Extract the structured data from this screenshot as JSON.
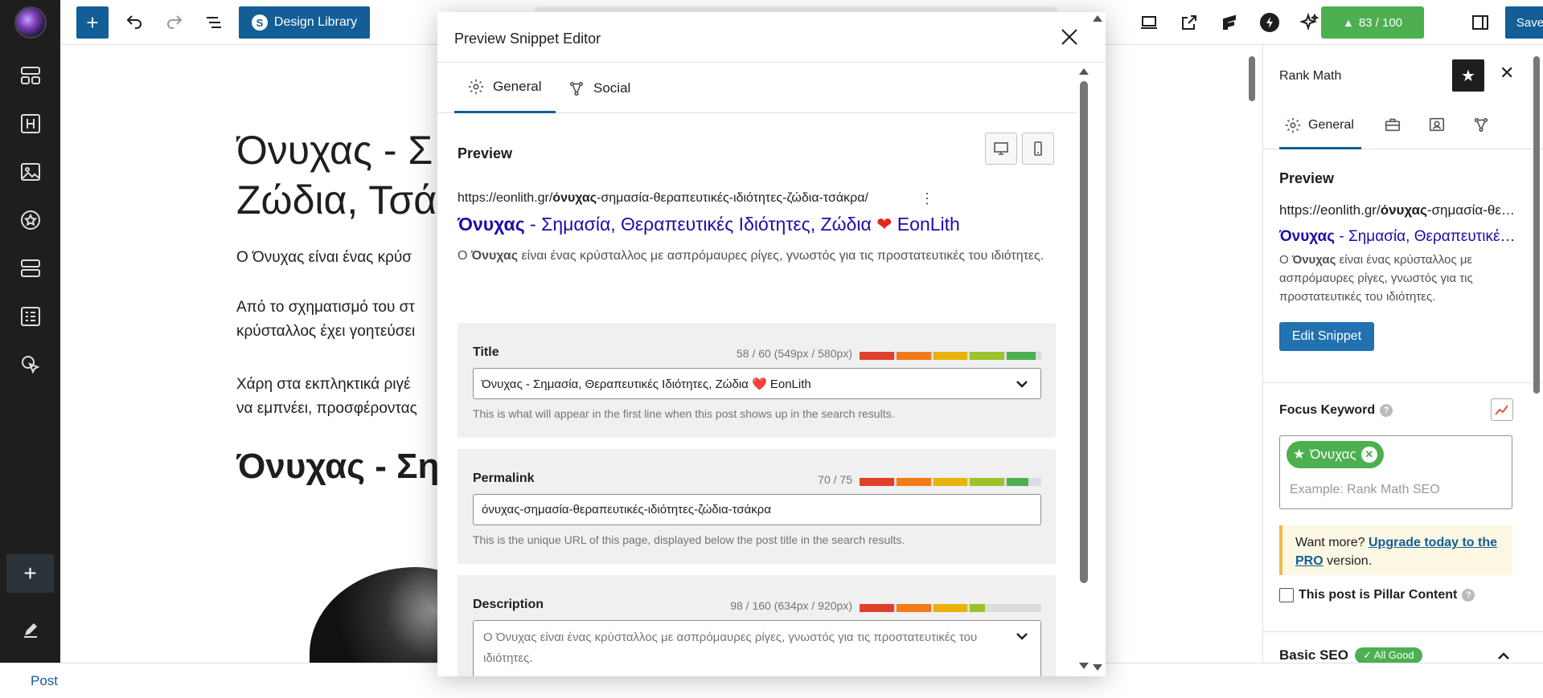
{
  "toolbar": {
    "design_library_label": "Design Library",
    "score_label": "83 / 100",
    "save_label": "Save"
  },
  "editor": {
    "title_line1": "Όνυχας - Σ",
    "title_line2": "Ζώδια, Τσά",
    "para1": "Ο Όνυχας είναι ένας κρύσ",
    "para2_line1": "Από το σχηματισμό του στ",
    "para2_line2": "κρύσταλλος έχει γοητεύσει",
    "para3_line1": "Χάρη στα εκπληκτικά ριγέ",
    "para3_line2": "να εμπνέει, προσφέροντας",
    "heading2": "Όνυχας - Ση"
  },
  "statusbar": {
    "label": "Post"
  },
  "sidebar": {
    "title": "Rank Math",
    "tab_general": "General",
    "preview_title": "Preview",
    "url_prefix": "https://eonlith.gr/",
    "url_bold": "όνυχας",
    "url_rest": "-σημασία-θεραπευτικές-ιδιότητες-ζώδια-τσάκρα/",
    "snippet_title_bold": "Όνυχας",
    "snippet_title_rest": " - Σημασία, Θεραπευτικές Ιδιότητες, Ζώδια ❤️ EonLith",
    "desc_prefix": "Ο ",
    "desc_bold": "Όνυχας",
    "desc_rest": " είναι ένας κρύσταλλος με ασπρόμαυρες ρίγες, γνωστός για τις προστατευτικές του ιδιότητες.",
    "edit_snippet_label": "Edit Snippet",
    "focus_keyword_label": "Focus Keyword",
    "keyword_chip": "Όνυχας",
    "keyword_placeholder": "Example: Rank Math SEO",
    "upsell_prefix": "Want more? ",
    "upsell_link": "Upgrade today to the PRO",
    "upsell_suffix": " version.",
    "pillar_label": "This post is Pillar Content",
    "basic_seo_label": "Basic SEO",
    "basic_seo_badge": "✓ All Good"
  },
  "modal": {
    "title": "Preview Snippet Editor",
    "tabs": [
      {
        "label": "General"
      },
      {
        "label": "Social"
      }
    ],
    "preview_label": "Preview",
    "url_prefix": "https://eonlith.gr/",
    "url_bold": "όνυχας",
    "url_rest": "-σημασία-θεραπευτικές-ιδιότητες-ζώδια-τσάκρα/",
    "snippet_title_bold": "Όνυχας",
    "snippet_title_mid": " - Σημασία, Θεραπευτικές Ιδιότητες, Ζώδια ",
    "snippet_title_heart": "❤",
    "snippet_title_end": " EonLith",
    "desc_prefix": "Ο ",
    "desc_bold": "Όνυχας",
    "desc_rest": " είναι ένας κρύσταλλος με ασπρόμαυρες ρίγες, γνωστός για τις προστατευτικές του ιδιότητες.",
    "title_field": {
      "label": "Title",
      "count": "58 / 60 (549px / 580px)",
      "value": "Όνυχας - Σημασία, Θεραπευτικές Ιδιότητες, Ζώδια ❤️ EonLith",
      "help": "This is what will appear in the first line when this post shows up in the search results.",
      "fill": 0.97
    },
    "permalink_field": {
      "label": "Permalink",
      "count": "70 / 75",
      "value": "όνυχας-σημασία-θεραπευτικές-ιδιότητες-ζώδια-τσάκρα",
      "help": "This is the unique URL of this page, displayed below the post title in the search results.",
      "fill": 0.93
    },
    "description_field": {
      "label": "Description",
      "count": "98 / 160 (634px / 920px)",
      "value": "Ο Όνυχας είναι ένας κρύσταλλος με ασπρόμαυρες ρίγες, γνωστός για τις προστατευτικές του ιδιότητες.",
      "fill": 0.69
    }
  },
  "colors": {
    "primary": "#135e96",
    "score_green": "#4caf50",
    "link_blue": "#1a0dab",
    "bar_red": "#e03f2b",
    "bar_orange": "#f07b18",
    "bar_yellow": "#e9b10c",
    "bar_lime": "#9bc22b",
    "bar_green": "#4caf50"
  }
}
